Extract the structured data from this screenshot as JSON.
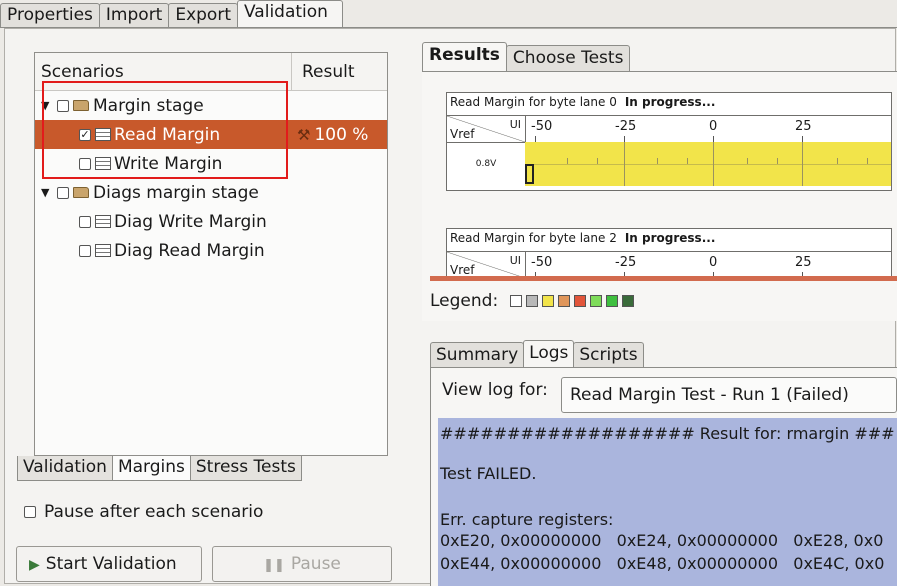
{
  "top_tabs": [
    "Properties",
    "Import",
    "Export",
    "Validation"
  ],
  "scenarios": {
    "col_scenarios": "Scenarios",
    "col_result": "Result",
    "rows": [
      {
        "label": "Margin stage",
        "result": ""
      },
      {
        "label": "Read Margin",
        "result": "100 %"
      },
      {
        "label": "Write Margin",
        "result": ""
      },
      {
        "label": "Diags margin stage",
        "result": ""
      },
      {
        "label": "Diag Write Margin",
        "result": ""
      },
      {
        "label": "Diag Read Margin",
        "result": ""
      }
    ]
  },
  "left_tabs": [
    "Validation",
    "Margins",
    "Stress Tests"
  ],
  "pause_label": "Pause after each scenario",
  "start_label": "Start Validation",
  "pause_button_label": "Pause",
  "results_tabs": [
    "Results",
    "Choose Tests"
  ],
  "margin_tables": [
    {
      "title": "Read Margin for byte lane 0",
      "status": "In progress...",
      "vref_label": "Vref",
      "ui_label": "UI",
      "row_label": "0.8V",
      "ticks": [
        "-50",
        "-25",
        "0",
        "25"
      ]
    },
    {
      "title": "Read Margin for byte lane 2",
      "status": "In progress...",
      "vref_label": "Vref",
      "ui_label": "UI",
      "ticks": [
        "-50",
        "-25",
        "0",
        "25"
      ]
    }
  ],
  "legend_label": "Legend:",
  "legend_colors": [
    "#ffffff",
    "#b8b8b8",
    "#f2e44a",
    "#e0965a",
    "#e2553a",
    "#7fdc5a",
    "#3fbf3f",
    "#3a6b3a"
  ],
  "bottom_tabs": [
    "Summary",
    "Logs",
    "Scripts"
  ],
  "view_log_label": "View log for:",
  "view_log_value": "Read Margin Test - Run 1 (Failed)",
  "log_lines": [
    "################### Result for: rmargin ###",
    "",
    "Test FAILED.",
    "",
    "Err. capture registers:",
    "0xE20, 0x00000000   0xE24, 0x00000000   0xE28, 0x0",
    "0xE44, 0x00000000   0xE48, 0x00000000   0xE4C, 0x0"
  ],
  "colors": {
    "selected_row": "#c8592b",
    "highlight_box": "#e21b1b",
    "margin_fill": "#f2e44a",
    "log_bg": "#aab5dd"
  }
}
